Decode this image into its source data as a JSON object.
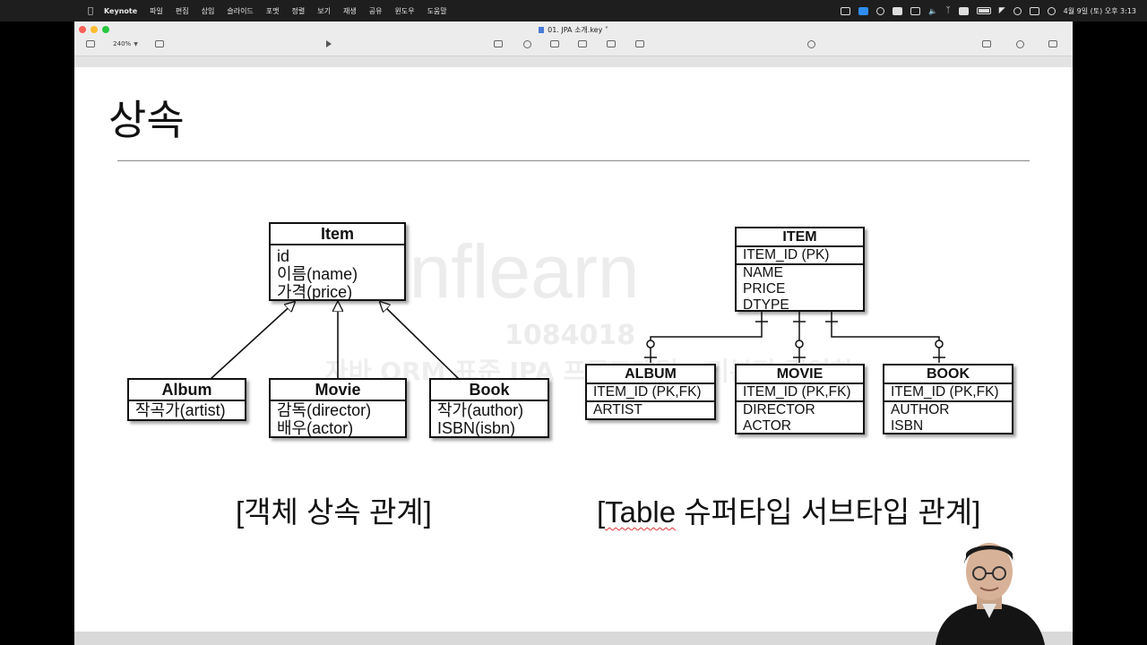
{
  "menubar": {
    "app_name": "Keynote",
    "items": [
      "파일",
      "편집",
      "삽입",
      "슬라이드",
      "포맷",
      "정렬",
      "보기",
      "재생",
      "공유",
      "윈도우",
      "도움말"
    ],
    "clock": "4월 9일 (토) 오후 3:13"
  },
  "window": {
    "doc_title": "01. JPA 소개.key",
    "zoom": "240%"
  },
  "slide": {
    "title": "상속",
    "watermark": {
      "brand": "inflearn",
      "number": "1084018",
      "subtitle": "자바 ORM 표준 JPA 프로그래밍 - 기본편 김영한"
    },
    "object_diagram": {
      "parent": {
        "name": "Item",
        "fields": [
          "id",
          "이름(name)",
          "가격(price)"
        ]
      },
      "children": [
        {
          "name": "Album",
          "fields": [
            "작곡가(artist)"
          ]
        },
        {
          "name": "Movie",
          "fields": [
            "감독(director)",
            "배우(actor)"
          ]
        },
        {
          "name": "Book",
          "fields": [
            "작가(author)",
            "ISBN(isbn)"
          ]
        }
      ],
      "caption": "[객체 상속 관계]"
    },
    "table_diagram": {
      "parent": {
        "name": "ITEM",
        "pk": "ITEM_ID (PK)",
        "columns": [
          "NAME",
          "PRICE",
          "DTYPE"
        ]
      },
      "children": [
        {
          "name": "ALBUM",
          "pk": "ITEM_ID (PK,FK)",
          "columns": [
            "ARTIST"
          ]
        },
        {
          "name": "MOVIE",
          "pk": "ITEM_ID (PK,FK)",
          "columns": [
            "DIRECTOR",
            "ACTOR"
          ]
        },
        {
          "name": "BOOK",
          "pk": "ITEM_ID (PK,FK)",
          "columns": [
            "AUTHOR",
            "ISBN"
          ]
        }
      ],
      "caption_word": "Table",
      "caption_rest": " 슈퍼타입 서브타입 관계]",
      "caption_open": "["
    }
  },
  "colors": {
    "menubar_bg": "#1e1e1e",
    "toolbar_bg": "#ececec",
    "slide_bg": "#ffffff",
    "line": "#111111"
  },
  "icons": [
    "apple-icon",
    "screen-record-icon",
    "siri-icon",
    "wifi-icon",
    "search-icon",
    "control-center-icon",
    "battery-icon",
    "bluetooth-icon",
    "volume-icon",
    "play-icon",
    "table-icon",
    "chart-icon",
    "text-icon",
    "shape-icon",
    "media-icon",
    "comment-icon",
    "collaborate-icon",
    "format-icon",
    "animate-icon",
    "document-icon"
  ]
}
